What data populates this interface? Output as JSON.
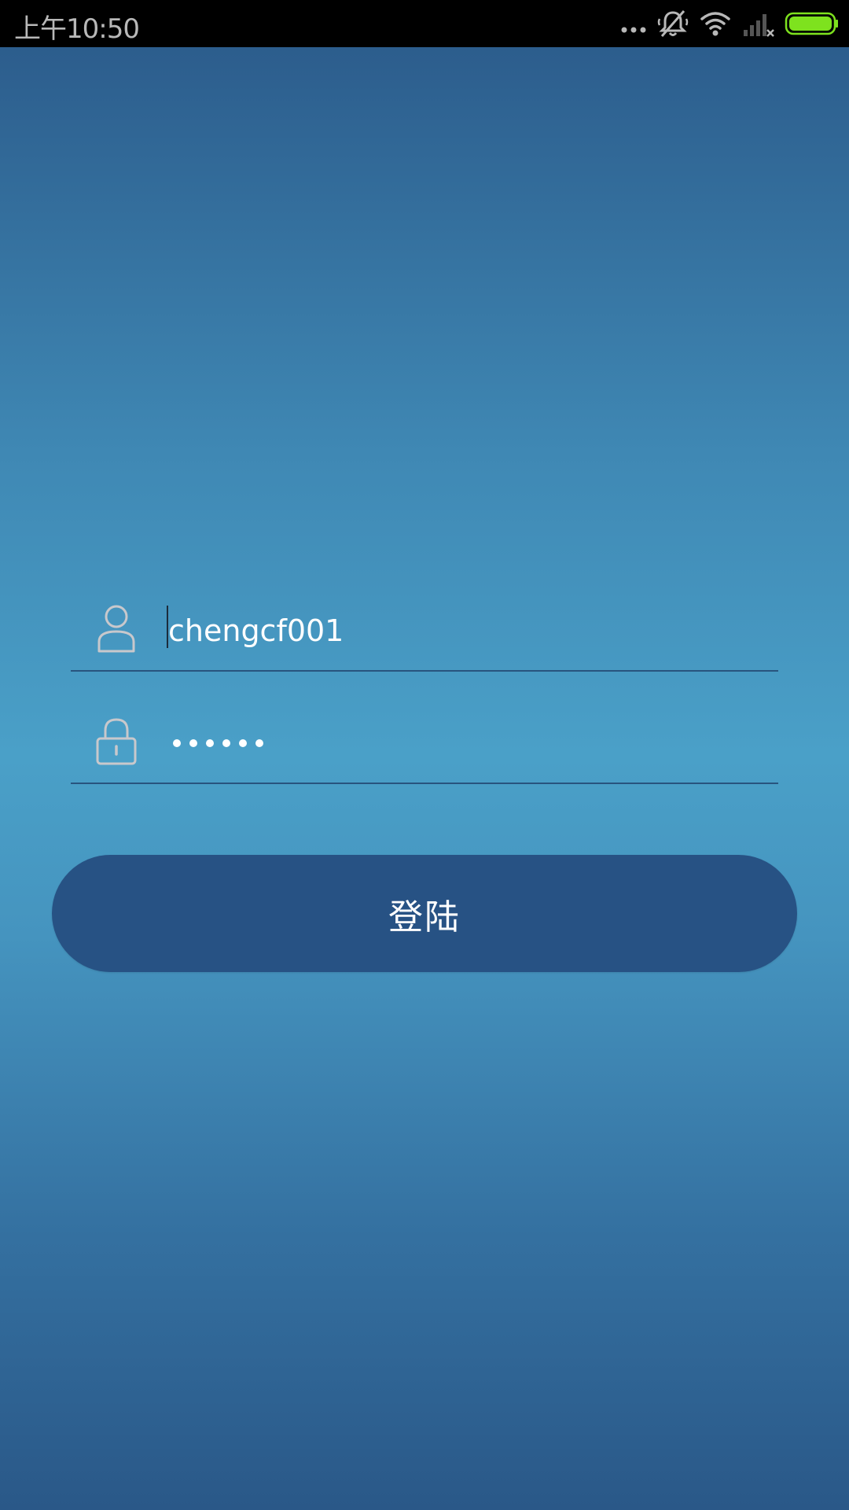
{
  "status_bar": {
    "time": "上午10:50",
    "icons": [
      "more-dots-icon",
      "bell-muted-icon",
      "wifi-icon",
      "cellular-no-signal-icon",
      "battery-full-icon"
    ],
    "battery_color": "#7ee21e"
  },
  "login": {
    "username_value": "chengcf001",
    "password_masked": "••••••",
    "password_length": 6,
    "submit_label": "登陆"
  },
  "colors": {
    "button": "#275284",
    "underline": "#28547e",
    "icon": "#c8c8cc"
  }
}
